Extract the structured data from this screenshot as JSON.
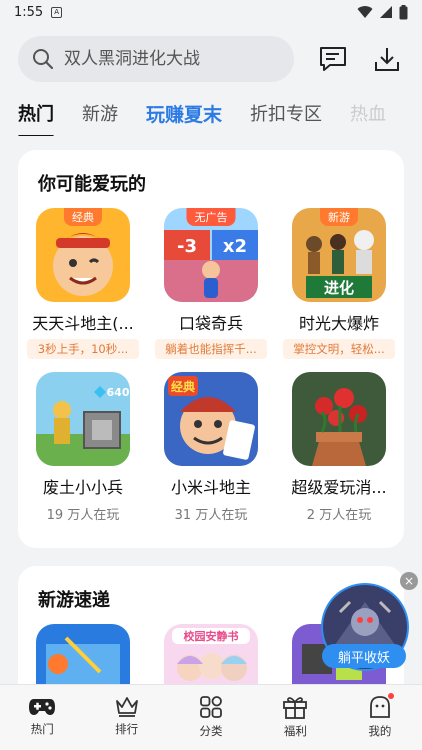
{
  "status": {
    "time": "1:55"
  },
  "search": {
    "placeholder": "双人黑洞进化大战"
  },
  "tabs": [
    {
      "label": "热门"
    },
    {
      "label": "新游"
    },
    {
      "label": "玩赚夏末"
    },
    {
      "label": "折扣专区"
    },
    {
      "label": "热血"
    }
  ],
  "recommend": {
    "title": "你可能爱玩的",
    "apps": [
      {
        "badge": "经典",
        "name": "天天斗地主(...",
        "tagline": "3秒上手，10秒..."
      },
      {
        "badge": "无广告",
        "name": "口袋奇兵",
        "tagline": "躺着也能指挥千..."
      },
      {
        "badge": "新游",
        "name": "时光大爆炸",
        "tagline": "掌控文明，轻松..."
      },
      {
        "name": "废土小小兵",
        "players": "19 万人在玩"
      },
      {
        "name": "小米斗地主",
        "players": "31 万人在玩"
      },
      {
        "name": "超级爱玩消...",
        "players": "2 万人在玩"
      }
    ]
  },
  "newgames": {
    "title": "新游速递"
  },
  "floating_ad": {
    "label": "躺平收妖",
    "close": "×"
  },
  "icon_text": {
    "game3_banner": "进化",
    "game2_left": "-3",
    "game2_right": "x2",
    "game4_gem": "640",
    "game5_label": "经典",
    "game_new2_label": "校园安静书"
  },
  "bottom_nav": [
    {
      "label": "热门"
    },
    {
      "label": "排行"
    },
    {
      "label": "分类"
    },
    {
      "label": "福利"
    },
    {
      "label": "我的"
    }
  ],
  "colors": {
    "accent": "#2c7be5",
    "tagline_text": "#e07a3a",
    "badge_orange": "#ff7a2e"
  }
}
